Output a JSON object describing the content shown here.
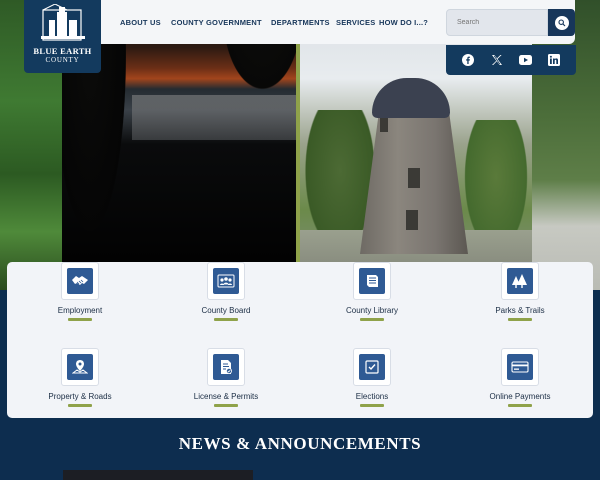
{
  "logo": {
    "line1": "BLUE EARTH",
    "line2": "COUNTY"
  },
  "nav": {
    "items": [
      "ABOUT US",
      "COUNTY GOVERNMENT",
      "DEPARTMENTS",
      "SERVICES",
      "HOW DO I...?"
    ]
  },
  "search": {
    "placeholder": "Search",
    "button_icon": "search-icon"
  },
  "social": {
    "icons": [
      "facebook-icon",
      "x-icon",
      "youtube-icon",
      "linkedin-icon"
    ]
  },
  "quick_links": [
    {
      "label": "Employment",
      "icon": "handshake-icon"
    },
    {
      "label": "County Board",
      "icon": "people-icon"
    },
    {
      "label": "County Library",
      "icon": "book-icon"
    },
    {
      "label": "Parks & Trails",
      "icon": "trees-icon"
    },
    {
      "label": "Property & Roads",
      "icon": "map-pin-icon"
    },
    {
      "label": "License & Permits",
      "icon": "document-icon"
    },
    {
      "label": "Elections",
      "icon": "ballot-check-icon"
    },
    {
      "label": "Online Payments",
      "icon": "payment-icon"
    }
  ],
  "news": {
    "title": "NEWS & ANNOUNCEMENTS"
  },
  "colors": {
    "navy": "#133a5e",
    "dark_navy": "#0d2d4f",
    "accent_green": "#8fa24a",
    "icon_blue": "#2f5a94"
  }
}
